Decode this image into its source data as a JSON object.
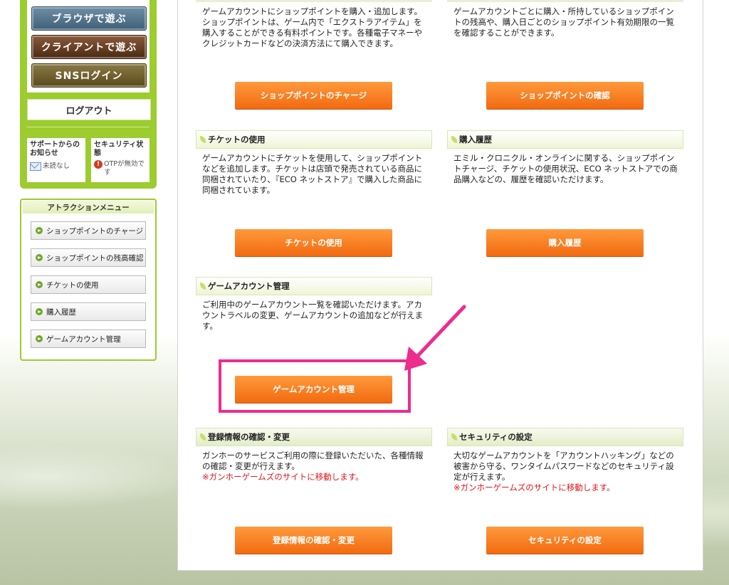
{
  "sidebar": {
    "play_browser": "ブラウザで遊ぶ",
    "play_client": "クライアントで遊ぶ",
    "sns_login": "SNSログイン",
    "logout": "ログアウト",
    "support_title": "サポートからのお知らせ",
    "support_status": "未読なし",
    "security_title": "セキュリティ状態",
    "security_status": "OTPが無効です",
    "attraction_menu_title": "アトラクションメニュー",
    "menu_items": [
      {
        "label": "ショップポイントのチャージ"
      },
      {
        "label": "ショップポイントの残高確認"
      },
      {
        "label": "チケットの使用"
      },
      {
        "label": "購入履歴"
      },
      {
        "label": "ゲームアカウント管理"
      }
    ]
  },
  "sections": {
    "charge": {
      "desc": "ゲームアカウントにショップポイントを購入・追加します。ショップポイントは、ゲーム内で「エクストラアイテム」を購入することができる有料ポイントです。各種電子マネーやクレジットカードなどの決済方法にて購入できます。",
      "button": "ショップポイントのチャージ"
    },
    "confirm": {
      "desc": "ゲームアカウントごとに購入・所持しているショップポイントの残高や、購入日ごとのショップポイント有効期限の一覧を確認することができます。",
      "button": "ショップポイントの確認"
    },
    "ticket": {
      "title": "チケットの使用",
      "desc": "ゲームアカウントにチケットを使用して、ショップポイントなどを追加します。チケットは店頭で発売されている商品に同梱されていたり、『ECO ネットストア』で購入した商品に同梱されています。",
      "button": "チケットの使用"
    },
    "history": {
      "title": "購入履歴",
      "desc": "エミル・クロニクル・オンラインに関する、ショップポイントチャージ、チケットの使用状況、ECO ネットストアでの商品購入などの、履歴を確認いただけます。",
      "button": "購入履歴"
    },
    "account": {
      "title": "ゲームアカウント管理",
      "desc": "ご利用中のゲームアカウント一覧を確認いただけます。アカウントラベルの変更、ゲームアカウントの追加などが行えます。",
      "button": "ゲームアカウント管理"
    },
    "registration": {
      "title": "登録情報の確認・変更",
      "desc": "ガンホーのサービスご利用の際に登録いただいた、各種情報の確認・変更が行えます。",
      "note": "※ガンホーゲームズのサイトに移動します。",
      "button": "登録情報の確認・変更"
    },
    "security": {
      "title": "セキュリティの設定",
      "desc": "大切なゲームアカウントを「アカウントハッキング」などの被害から守る、ワンタイムパスワードなどのセキュリティ設定が行えます。",
      "note": "※ガンホーゲームズのサイトに移動します。",
      "button": "セキュリティの設定"
    }
  },
  "colors": {
    "accent_orange": "#f26a10",
    "sidebar_green": "#9ccc2e",
    "highlight_pink": "#ee2c8c",
    "note_red": "#e0151a"
  }
}
